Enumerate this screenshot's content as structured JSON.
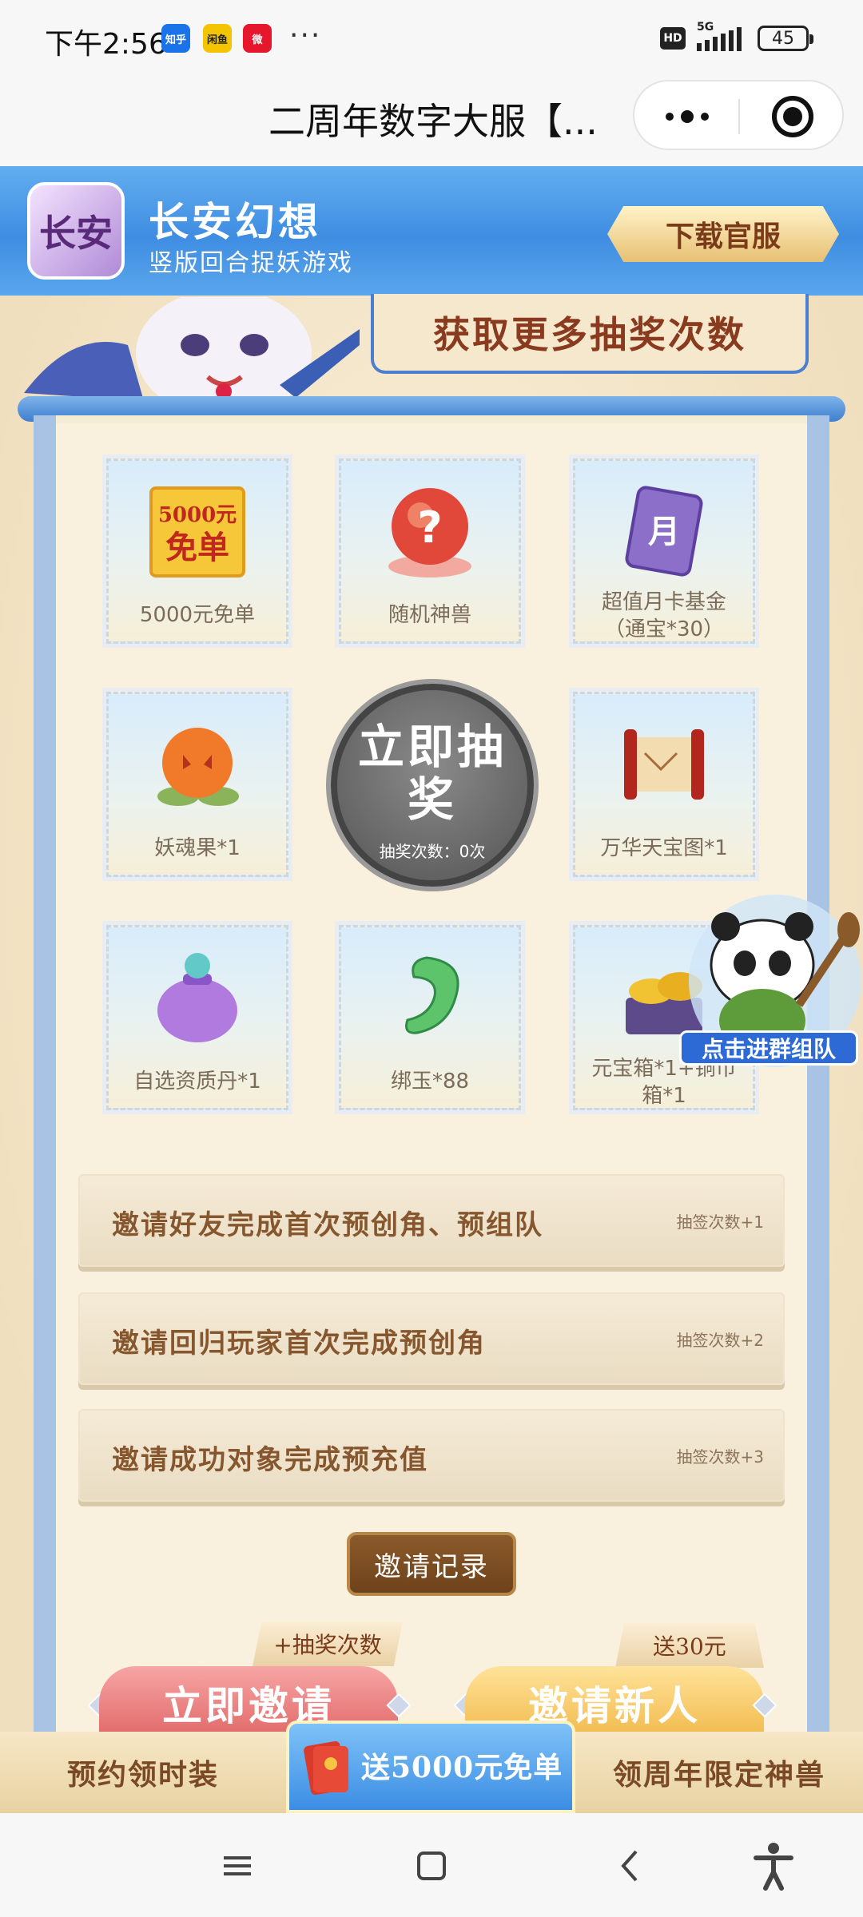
{
  "status_bar": {
    "time": "下午2:56",
    "apps": [
      {
        "name": "zhihu-icon",
        "text": "知乎",
        "color": "#1a73e8"
      },
      {
        "name": "xianyu-icon",
        "text": "闲鱼",
        "color": "#f5c400"
      },
      {
        "name": "weibo-icon",
        "text": "微",
        "color": "#e6162d"
      }
    ],
    "more": "···",
    "hd": "HD",
    "network": "5G",
    "battery": "45"
  },
  "title_bar": {
    "title": "二周年数字大服【..."
  },
  "game": {
    "logo_text": "长安",
    "name": "长安幻想",
    "slogan": "竖版回合捉妖游戏",
    "download_label": "下载官服"
  },
  "banner": {
    "more_draws": "获取更多抽奖次数"
  },
  "prizes": [
    {
      "label": "5000元免单",
      "icon": "free-order-icon",
      "badge_top": "5000元",
      "badge_bottom": "免单"
    },
    {
      "label": "随机神兽",
      "icon": "mystery-orb-icon"
    },
    {
      "label": "超值月卡基金（通宝*30）",
      "icon": "month-card-icon",
      "card_char": "月"
    },
    {
      "label": "妖魂果*1",
      "icon": "demon-fruit-icon"
    },
    {
      "label": "万华天宝图*1",
      "icon": "treasure-scroll-icon"
    },
    {
      "label": "自选资质丹*1",
      "icon": "pill-bag-icon"
    },
    {
      "label": "绑玉*88",
      "icon": "jade-icon"
    },
    {
      "label": "元宝箱*1+铜币箱*1",
      "icon": "gold-chest-icon"
    }
  ],
  "draw": {
    "button_text": "立即抽奖",
    "count_text": "抽奖次数：0次",
    "count": 0
  },
  "floating": {
    "label": "点击进群组队"
  },
  "tasks": [
    {
      "text": "邀请好友完成首次预创角、预组队",
      "reward": "抽签次数+1"
    },
    {
      "text": "邀请回归玩家首次完成预创角",
      "reward": "抽签次数+2"
    },
    {
      "text": "邀请成功对象完成预充值",
      "reward": "抽签次数+3"
    }
  ],
  "invite_record_label": "邀请记录",
  "invite_now": {
    "tag": "+抽奖次数",
    "label": "立即邀请"
  },
  "invite_new": {
    "tag": "送30元",
    "label": "邀请新人"
  },
  "bottom_tabs": {
    "left": "预约领时装",
    "center": "送5000元免单",
    "right": "领周年限定神兽"
  },
  "colors": {
    "header_blue": "#3f8de2",
    "title_brown": "#8a3a1e",
    "panel_cream": "#f9f0de"
  }
}
